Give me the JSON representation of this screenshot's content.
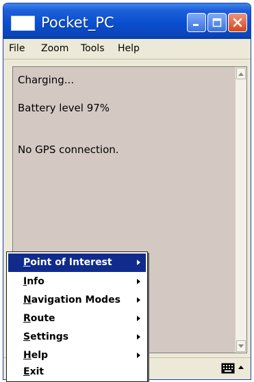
{
  "window": {
    "title": "Pocket_PC"
  },
  "menubar": {
    "file": "File",
    "zoom": "Zoom",
    "tools": "Tools",
    "help": "Help"
  },
  "content": {
    "status_charging": "Charging...",
    "status_battery": "Battery level 97%",
    "status_gps": "No GPS connection."
  },
  "popup_menu": {
    "items": [
      {
        "label": "Point of Interest",
        "has_submenu": true,
        "selected": true
      },
      {
        "label": "Info",
        "has_submenu": true,
        "selected": false
      },
      {
        "label": "Navigation Modes",
        "has_submenu": true,
        "selected": false
      },
      {
        "label": "Route",
        "has_submenu": true,
        "selected": false
      },
      {
        "label": "Settings",
        "has_submenu": true,
        "selected": false
      },
      {
        "label": "Help",
        "has_submenu": true,
        "selected": false
      },
      {
        "label": "Exit",
        "has_submenu": false,
        "selected": false
      }
    ]
  },
  "icons": {
    "app": "window-icon",
    "minimize": "minimize-icon",
    "maximize": "maximize-icon",
    "close": "close-icon",
    "keyboard": "keyboard-icon",
    "sip_arrow": "triangle-up-icon"
  },
  "colors": {
    "titlebar": "#0a4fd0",
    "content_background": "#d4c9c2",
    "menu_highlight": "#102b8c",
    "close_button": "#d3471f"
  }
}
